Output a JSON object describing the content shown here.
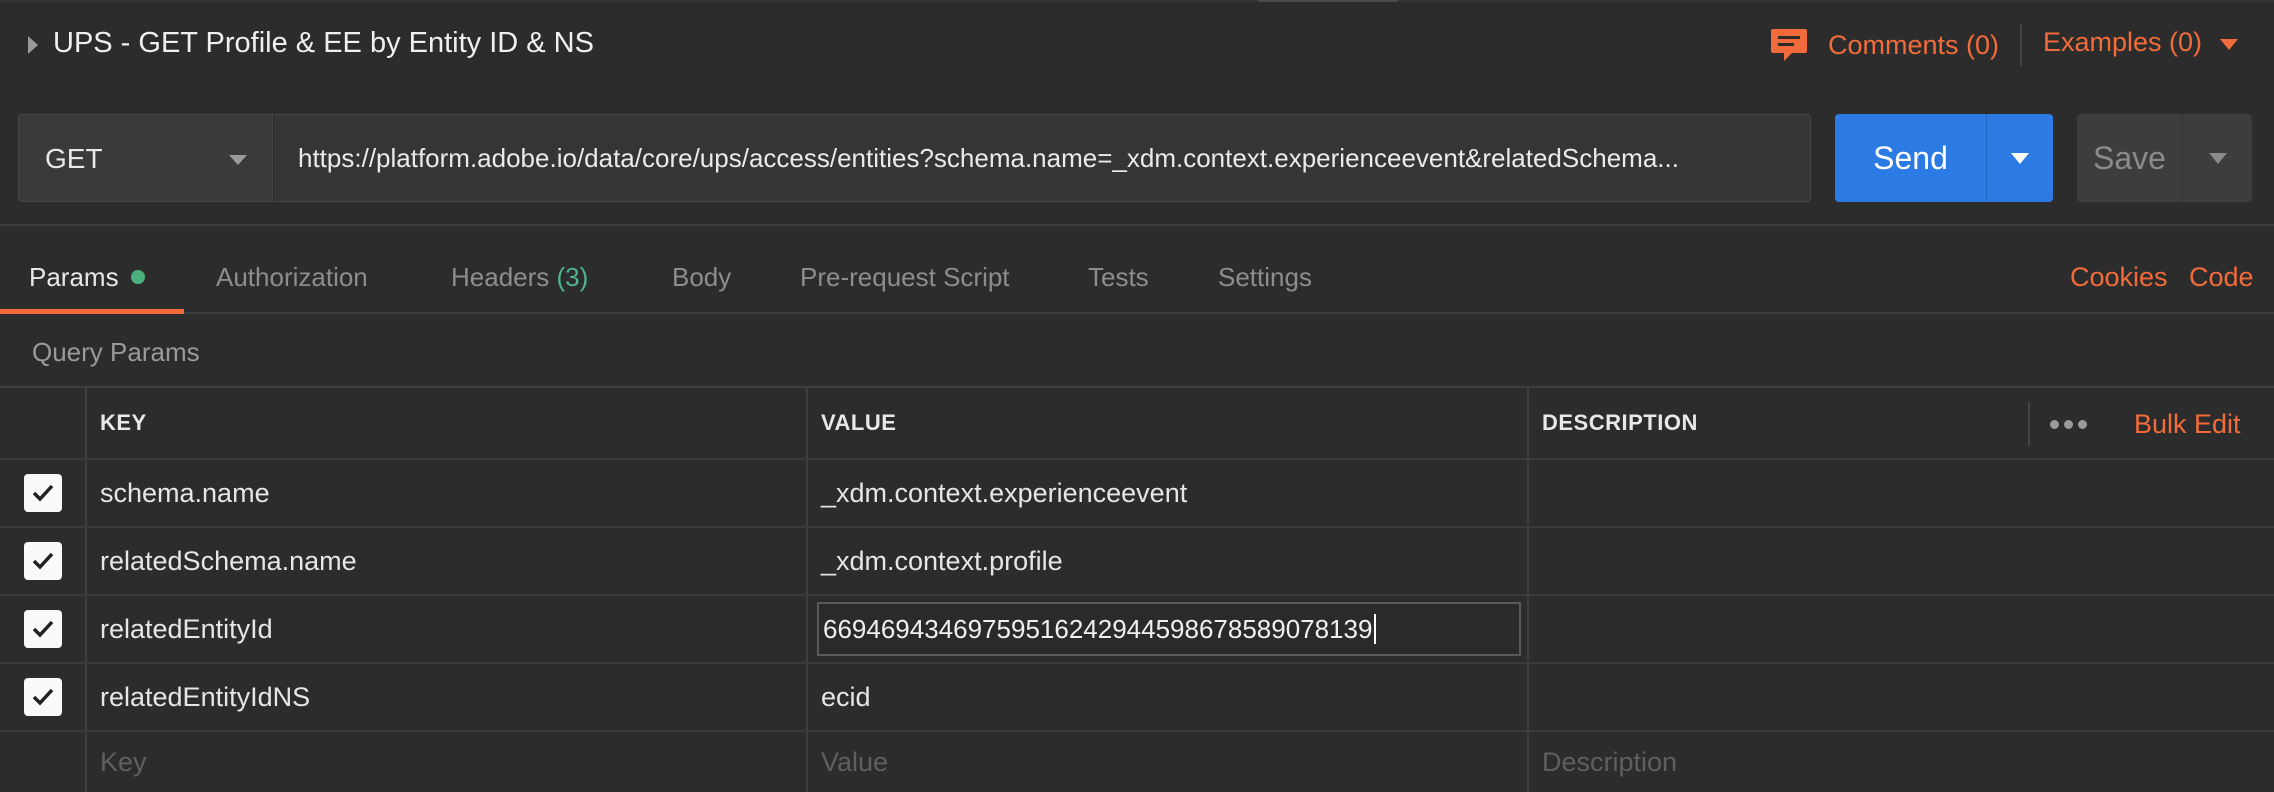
{
  "request": {
    "title": "UPS - GET Profile & EE by Entity ID & NS",
    "comments_label": "Comments (0)",
    "examples_label": "Examples (0)",
    "method": "GET",
    "url": "https://platform.adobe.io/data/core/ups/access/entities?schema.name=_xdm.context.experienceevent&relatedSchema...",
    "send_label": "Send",
    "save_label": "Save"
  },
  "tabs": {
    "params": "Params",
    "authorization": "Authorization",
    "headers": "Headers",
    "headers_count": "(3)",
    "body": "Body",
    "prerequest": "Pre-request Script",
    "tests": "Tests",
    "settings": "Settings",
    "cookies": "Cookies",
    "code": "Code"
  },
  "query_params": {
    "title": "Query Params",
    "columns": {
      "key": "KEY",
      "value": "VALUE",
      "description": "DESCRIPTION"
    },
    "bulk_edit": "Bulk Edit",
    "rows": [
      {
        "key": "schema.name",
        "value": "_xdm.context.experienceevent",
        "checked": true
      },
      {
        "key": "relatedSchema.name",
        "value": "_xdm.context.profile",
        "checked": true
      },
      {
        "key": "relatedEntityId",
        "value": "66946943469759516242944598678589078139",
        "checked": true,
        "editing": true
      },
      {
        "key": "relatedEntityIdNS",
        "value": "ecid",
        "checked": true
      }
    ],
    "placeholders": {
      "key": "Key",
      "value": "Value",
      "description": "Description"
    }
  },
  "colors": {
    "accent": "#f26b3a",
    "primary": "#2c7be5",
    "success": "#4caf7d",
    "background": "#2c2c2c"
  },
  "icons": [
    "caret-right-icon",
    "comment-icon",
    "chevron-down-icon",
    "checkmark-icon",
    "more-dots-icon"
  ]
}
